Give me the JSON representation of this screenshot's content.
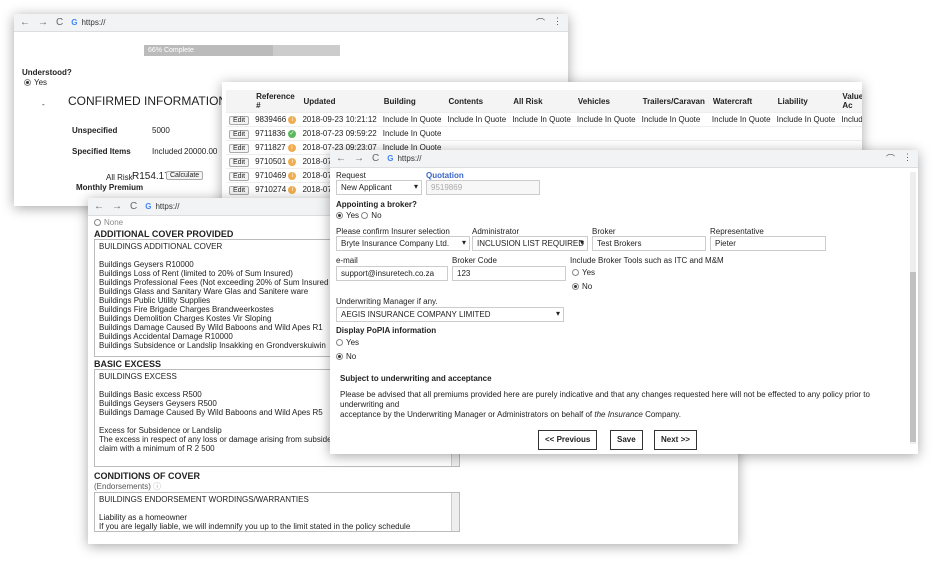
{
  "url": "https://",
  "w1": {
    "progress_label": "66% Complete",
    "progress_value": 0.66,
    "understood": "Understood?",
    "yes": "Yes",
    "dash": "-",
    "confirmed": "CONFIRMED INFORMATION",
    "unspecified": "Unspecified",
    "unspecified_val": "5000",
    "specified": "Specified Items",
    "included": "Included",
    "specified_val": "20000.00",
    "allrisk": "All Risk",
    "allrisk_val": "R154.17",
    "calculate": "Calculate",
    "monthly": "Monthly Premium"
  },
  "w2": {
    "headers": [
      "Reference #",
      "Updated",
      "Building",
      "Contents",
      "All Risk",
      "Vehicles",
      "Trailers/Caravan",
      "Watercraft",
      "Liability",
      "Value Ac"
    ],
    "edit": "Edit",
    "rows": [
      {
        "ref": "9839466",
        "status": "info",
        "updated": "2018-09-23 10:21:12",
        "cells": [
          "Include In Quote",
          "Include In Quote",
          "Include In Quote",
          "Include In Quote",
          "Include In Quote",
          "Include In Quote",
          "Include In Quote",
          "Include In"
        ]
      },
      {
        "ref": "9711836",
        "status": "ok",
        "updated": "2018-07-23 09:59:22",
        "cells": [
          "Include In Quote"
        ]
      },
      {
        "ref": "9711827",
        "status": "info",
        "updated": "2018-07-23 09:23:07",
        "cells": [
          "Include In Quote"
        ]
      },
      {
        "ref": "9710501",
        "status": "info",
        "updated": "2018-07",
        "cells": []
      },
      {
        "ref": "9710469",
        "status": "info",
        "updated": "2018-07",
        "cells": []
      },
      {
        "ref": "9710274",
        "status": "info",
        "updated": "2018-07",
        "cells": []
      }
    ]
  },
  "w3": {
    "none": "None",
    "additional_title": "ADDITIONAL COVER PROVIDED",
    "additional_lines": [
      "BUILDINGS ADDITIONAL COVER",
      "",
      "Buildings Geysers R10000",
      "Buildings Loss of Rent (limited to 20% of Sum Insured)",
      "Buildings Professional Fees (Not exceeding 20% of Sum Insured",
      "Buildings Glass and Sanitary Ware Glas and Sanitere ware",
      "Buildings Public Utility Supplies",
      "Buildings Fire Brigade Charges Brandweerkostes",
      "Buildings Demolition Charges Kostes Vir Sloping",
      "Buildings Damage Caused By Wild Baboons and Wild Apes  R1",
      "Buildings Accidental Damage R10000",
      "Buildings Subsidence or Landslip Insakking en Grondverskuiwin"
    ],
    "basic_title": "BASIC EXCESS",
    "basic_lines": [
      "BUILDINGS EXCESS",
      "",
      "Buildings Basic excess  R500",
      "Buildings Geysers Geysers  R500",
      "Buildings Damage Caused By Wild Baboons and Wild Apes  R5",
      "",
      "Excess for Subsidence or Landslip",
      "The excess in respect of any loss or damage arising from subsidence or landslip is 5% of the",
      "claim with a minimum of R 2 500"
    ],
    "conditions_title": "CONDITIONS OF COVER",
    "endorsements": "(Endorsements)",
    "conditions_lines": [
      "BUILDINGS ENDORSEMENT WORDINGS/WARRANTIES",
      "",
      "Liability as a homeowner",
      "If you are legally liable, we will indemnify you up to the limit stated in the policy schedule"
    ]
  },
  "w4": {
    "request": "Request",
    "quotation": "Quotation",
    "request_val": "New Applicant",
    "quotation_val": "9519869",
    "appointing": "Appointing a broker?",
    "yes": "Yes",
    "no": "No",
    "insurer_lbl": "Please confirm Insurer selection",
    "insurer_val": "Bryte Insurance Company Ltd.",
    "admin_lbl": "Administrator",
    "admin_val": "INCLUSION LIST REQUIRED",
    "broker_lbl": "Broker",
    "broker_val": "Test Brokers",
    "rep_lbl": "Representative",
    "rep_val": "Pieter",
    "email_lbl": "e-mail",
    "email_val": "support@insuretech.co.za",
    "code_lbl": "Broker Code",
    "code_val": "123",
    "tools_lbl": "Include Broker Tools such as ITC and M&M",
    "uw_lbl": "Underwriting Manager if any.",
    "uw_val": "AEGIS INSURANCE COMPANY LIMITED",
    "popia": "Display PoPIA information",
    "subject": "Subject to underwriting and acceptance",
    "advise1": "Please be advised that all premiums provided here are purely indicative and that any changes requested here will not be effected to any policy prior to underwriting and",
    "advise2a": "acceptance by the Underwriting Manager or Administrators on behalf of ",
    "advise2b": "the Insurance",
    "advise2c": " Company.",
    "prev": "<< Previous",
    "save": "Save",
    "next": "Next >>"
  }
}
